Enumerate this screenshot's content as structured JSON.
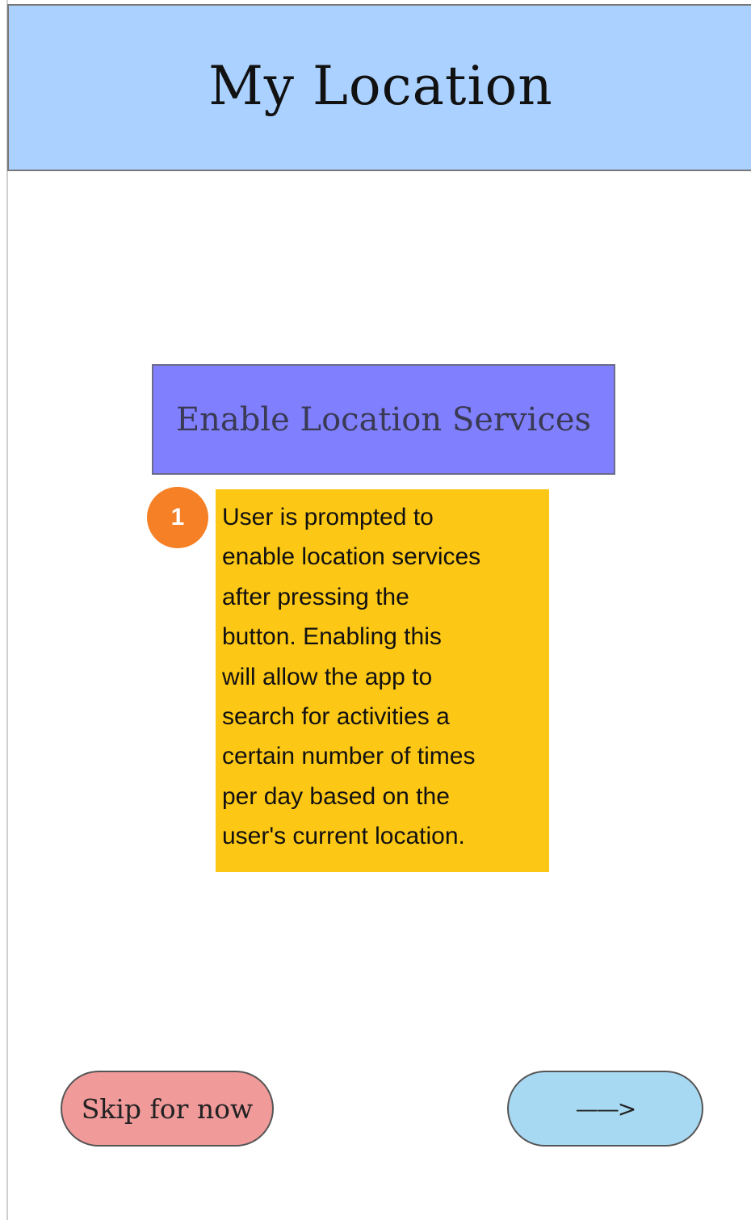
{
  "header": {
    "title": "My Location"
  },
  "main": {
    "enable_button_label": "Enable Location Services",
    "note": {
      "badge_number": "1",
      "text_lines": [
        "User is prompted to",
        "enable location services",
        "after pressing the",
        "button. Enabling this",
        "will allow the app to",
        "search for activities a",
        "certain number of times",
        "per day based on the",
        "user's current location."
      ]
    }
  },
  "footer": {
    "skip_label": "Skip for now",
    "next_label": "——>"
  },
  "colors": {
    "header_bg": "#aad1ff",
    "enable_button_bg": "#8080ff",
    "note_bg": "#fdc715",
    "badge_bg": "#f58025",
    "skip_button_bg": "#f09a9a",
    "next_button_bg": "#a8d9f2"
  }
}
